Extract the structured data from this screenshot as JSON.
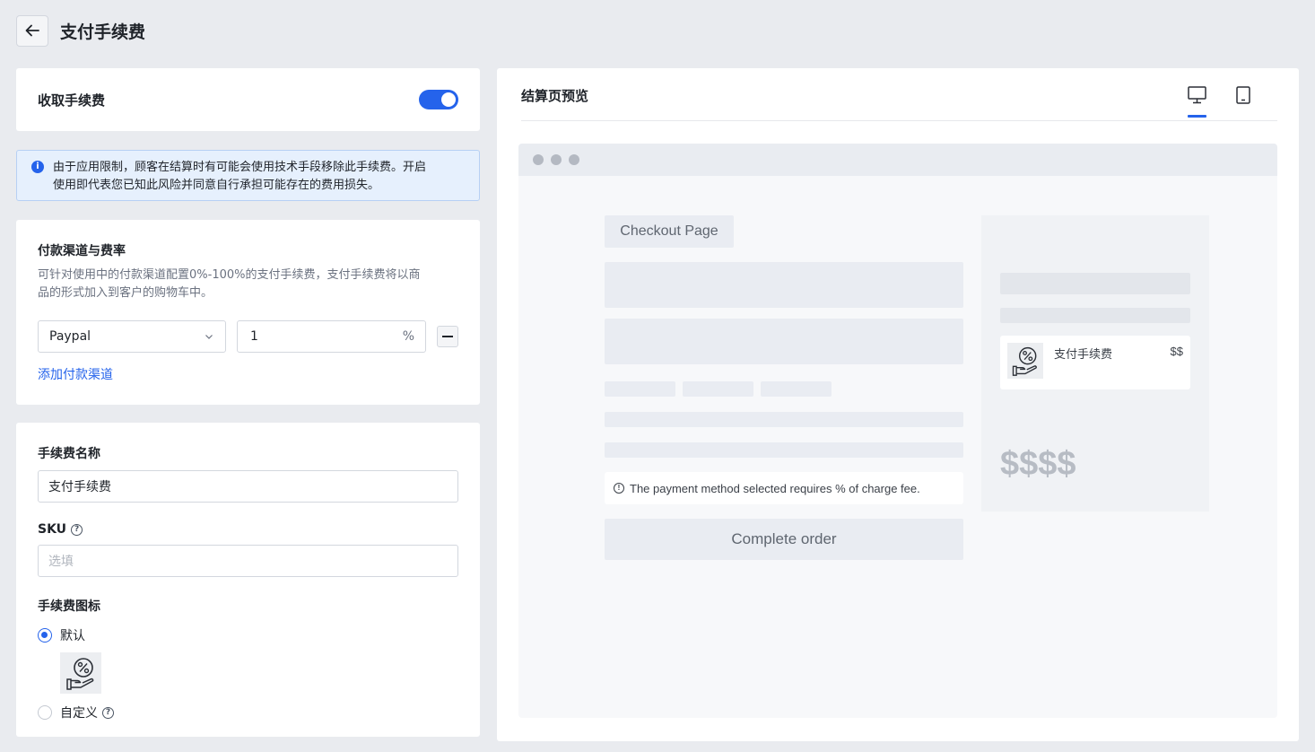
{
  "header": {
    "title": "支付手续费"
  },
  "toggle_card": {
    "label": "收取手续费",
    "enabled": true,
    "accent": "#2563eb"
  },
  "notice": {
    "icon": "info-icon",
    "text_line1": "由于应用限制，顾客在结算时有可能会使用技术手段移除此手续费。开启",
    "text_line2": "使用即代表您已知此风险并同意自行承担可能存在的费用损失。"
  },
  "channels": {
    "title": "付款渠道与费率",
    "desc_line1": "可针对使用中的付款渠道配置0%-100%的支付手续费，支付手续费将以商",
    "desc_line2": "品的形式加入到客户的购物车中。",
    "rows": [
      {
        "channel": "Paypal",
        "rate": "1",
        "unit": "%"
      }
    ],
    "add_link": "添加付款渠道"
  },
  "fee_form": {
    "name_label": "手续费名称",
    "name_value": "支付手续费",
    "sku_label": "SKU",
    "sku_placeholder": "选填",
    "icon_label": "手续费图标",
    "option_default": "默认",
    "option_custom": "自定义"
  },
  "preview": {
    "title": "结算页预览",
    "device_selected": "desktop",
    "checkout_label": "Checkout Page",
    "fee_notice": "The payment method selected requires % of charge fee.",
    "complete_button": "Complete order",
    "fee_item_name": "支付手续费",
    "fee_item_price": "$$",
    "total": "$$$$"
  }
}
